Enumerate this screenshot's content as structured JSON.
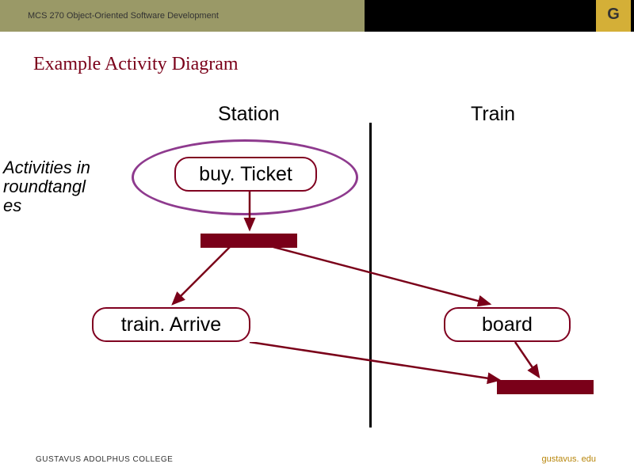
{
  "header": {
    "course": "MCS 270 Object-Oriented Software Development",
    "logo_letter": "G"
  },
  "title": "Example Activity Diagram",
  "swimlanes": {
    "left": "Station",
    "right": "Train"
  },
  "annotation": "Activities in\nroundtangl\nes",
  "activities": {
    "buy": "buy. Ticket",
    "arrive": "train. Arrive",
    "board": "board"
  },
  "footer": {
    "left": "GUSTAVUS ADOLPHUS COLLEGE",
    "right": "gustavus. edu"
  },
  "colors": {
    "olive": "#9a9967",
    "maroon": "#7a0019",
    "activity_border": "#800020",
    "purple": "#8e3a8e",
    "gold": "#d4af37"
  }
}
